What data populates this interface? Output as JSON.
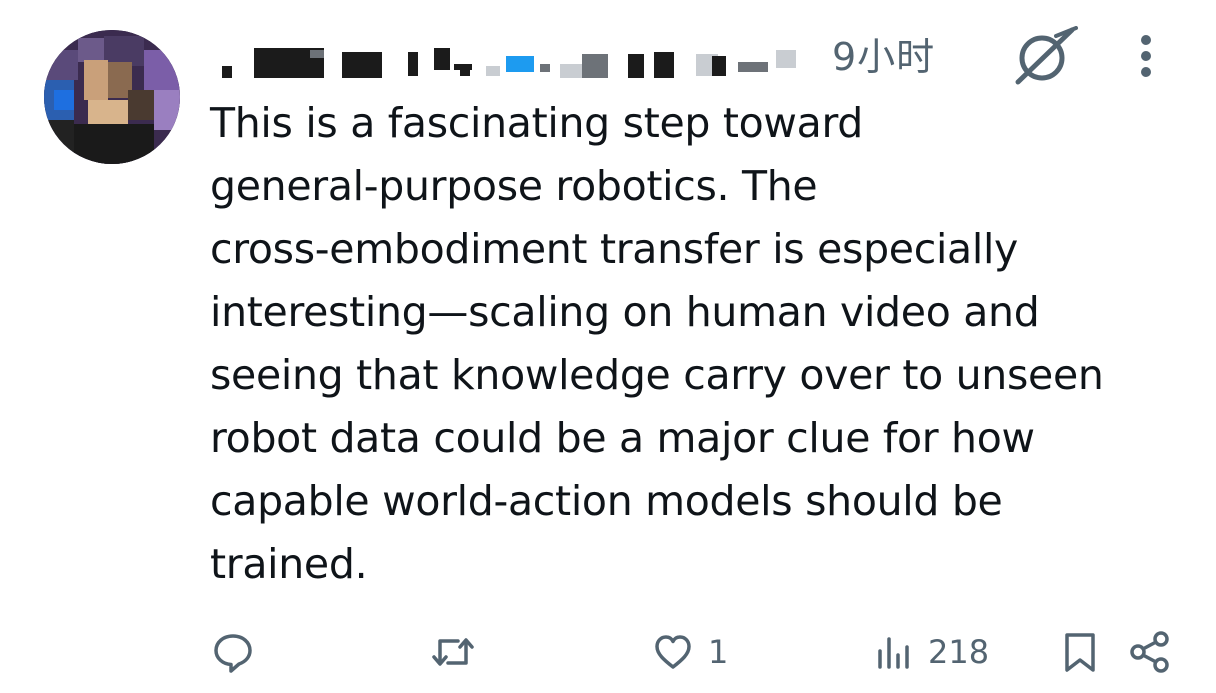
{
  "post": {
    "timestamp": "9小时",
    "text": "This is a fascinating step toward\ngeneral-purpose robotics. The\ncross-embodiment transfer is especially\ninteresting—scaling on human video and\nseeing that knowledge carry over to unseen\nrobot data could be a major clue for how\ncapable world-action models should be\ntrained."
  },
  "actions": {
    "reply_count": "",
    "repost_count": "",
    "like_count": "1",
    "views_count": "218"
  },
  "icons": {
    "grok": "grok-icon",
    "more": "more-vertical-icon",
    "reply": "reply-icon",
    "repost": "repost-icon",
    "like": "heart-icon",
    "views": "views-icon",
    "bookmark": "bookmark-icon",
    "share": "share-icon"
  },
  "colors": {
    "text": "#0f1419",
    "muted": "#536471",
    "background": "#ffffff"
  }
}
